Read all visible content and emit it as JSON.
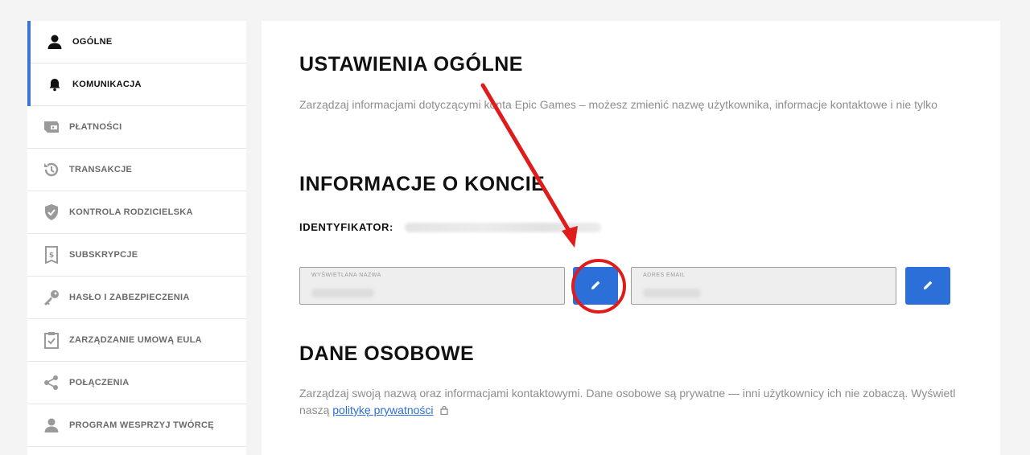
{
  "sidebar": {
    "items": [
      {
        "label": "OGÓLNE",
        "icon": "user-icon",
        "active": true
      },
      {
        "label": "KOMUNIKACJA",
        "icon": "bell-icon",
        "active": true
      },
      {
        "label": "PŁATNOŚCI",
        "icon": "wallet-icon",
        "active": false
      },
      {
        "label": "TRANSAKCJE",
        "icon": "history-icon",
        "active": false
      },
      {
        "label": "KONTROLA RODZICIELSKA",
        "icon": "shield-check-icon",
        "active": false
      },
      {
        "label": "SUBSKRYPCJE",
        "icon": "subscription-icon",
        "active": false
      },
      {
        "label": "HASŁO I ZABEZPIECZENIA",
        "icon": "key-icon",
        "active": false
      },
      {
        "label": "ZARZĄDZANIE UMOWĄ EULA",
        "icon": "clipboard-check-icon",
        "active": false
      },
      {
        "label": "POŁĄCZENIA",
        "icon": "share-icon",
        "active": false
      },
      {
        "label": "PROGRAM WESPRZYJ TWÓRCĘ",
        "icon": "creator-icon",
        "active": false
      }
    ]
  },
  "main": {
    "title": "USTAWIENIA OGÓLNE",
    "description": "Zarządzaj informacjami dotyczącymi konta Epic Games – możesz zmienić nazwę użytkownika, informacje kontaktowe i nie tylko",
    "account_section_title": "INFORMACJE O KONCIE",
    "id_label": "IDENTYFIKATOR:",
    "display_name_label": "WYŚWIETLANA NAZWA",
    "email_label": "ADRES EMAIL",
    "personal_section_title": "DANE OSOBOWE",
    "personal_description": "Zarządzaj swoją nazwą oraz informacjami kontaktowymi. Dane osobowe są prywatne — inni użytkownicy ich nie zobaczą. Wyświetl naszą",
    "privacy_link": "politykę prywatności"
  },
  "colors": {
    "accent": "#2c6fd8",
    "active_indicator": "#3a74d4",
    "annotation": "#e01b1b"
  }
}
